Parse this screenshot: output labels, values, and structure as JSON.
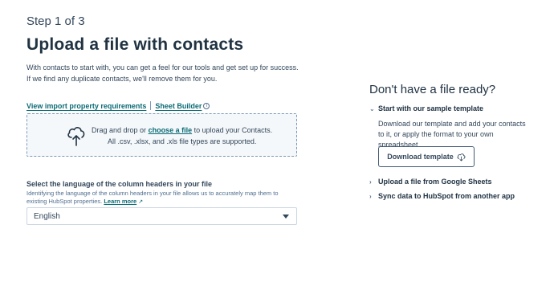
{
  "header": {
    "step": "Step 1 of 3",
    "title": "Upload a file with contacts",
    "desc_line1": "With contacts to start with, you can get a feel for our tools and get set up for success.",
    "desc_line2": "If we find any duplicate contacts, we'll remove them for you."
  },
  "links": {
    "import_requirements": "View import property requirements",
    "sheet_builder": "Sheet Builder"
  },
  "dropzone": {
    "text_before": "Drag and drop or",
    "choose_link": "choose a file",
    "text_after": "to upload your Contacts.",
    "supported": "All .csv, .xlsx, and .xls file types are supported."
  },
  "language": {
    "label": "Select the language of the column headers in your file",
    "help": "Identifying the language of the column headers in your file allows us to accurately map them to existing HubSpot properties.",
    "learn_more": "Learn more",
    "selected": "English"
  },
  "sidebar": {
    "title": "Don't have a file ready?",
    "sample_title": "Start with our sample template",
    "sample_body": "Download our template and add your contacts to it, or apply the format to your own spreadsheet.",
    "download_button": "Download template",
    "google_sheets": "Upload a file from Google Sheets",
    "sync_data": "Sync data to HubSpot from another app"
  },
  "icons": [
    "cloud-upload-icon",
    "info-icon",
    "external-link-icon",
    "chevron-down-icon",
    "chevron-right-icon",
    "dropdown-caret-icon"
  ]
}
